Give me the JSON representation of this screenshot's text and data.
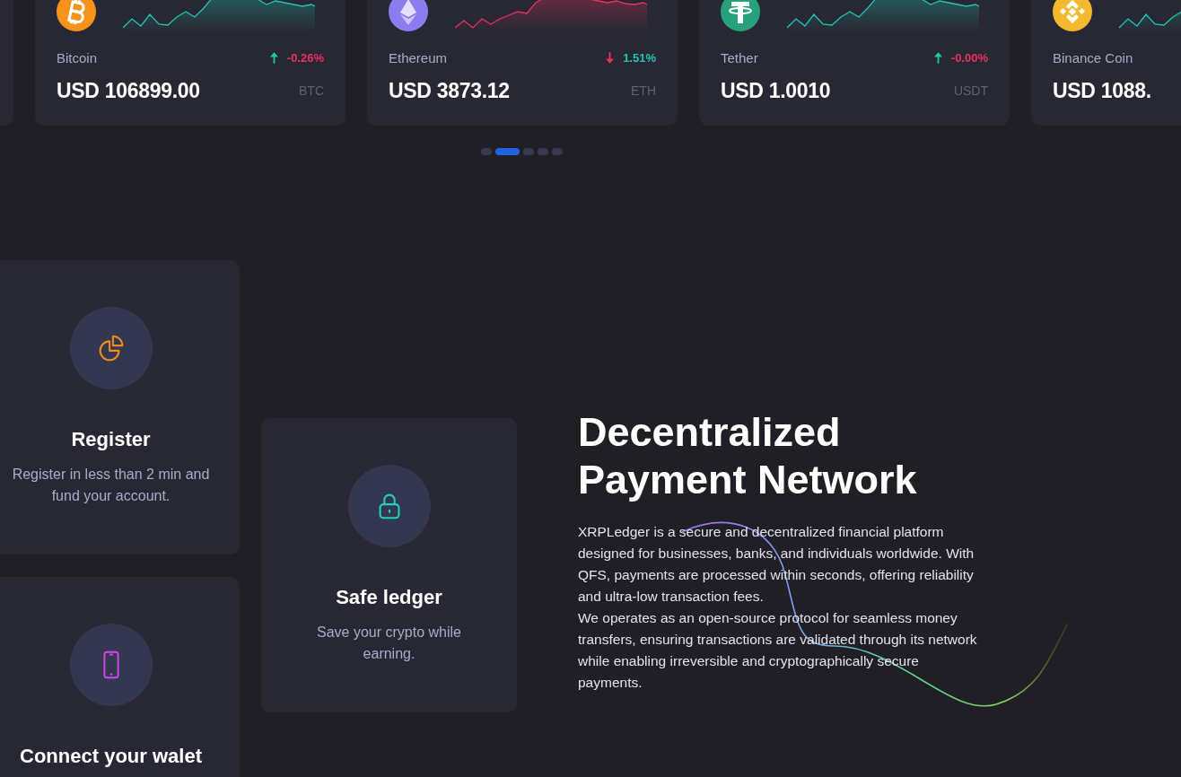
{
  "tickers": [
    {
      "kind": "bitcoin",
      "name": "Bitcoin",
      "rising": true,
      "change": "-0.26%",
      "loss": true,
      "price": "USD 106899.00",
      "symbol": "BTC",
      "chart_falling": false
    },
    {
      "kind": "ethereum",
      "name": "Ethereum",
      "rising": false,
      "change": "1.51%",
      "loss": false,
      "price": "USD 3873.12",
      "symbol": "ETH",
      "chart_falling": true
    },
    {
      "kind": "tether",
      "name": "Tether",
      "rising": true,
      "change": "-0.00%",
      "loss": true,
      "price": "USD 1.0010",
      "symbol": "USDT",
      "chart_falling": false
    },
    {
      "kind": "binance",
      "name": "Binance Coin",
      "price": "USD 1088.",
      "chart_falling": false
    }
  ],
  "pager": [
    {
      "selected": false
    },
    {
      "selected": true
    },
    {
      "selected": false
    },
    {
      "selected": false
    },
    {
      "selected": false
    }
  ],
  "features": [
    {
      "kind": "chart",
      "title": "Register",
      "text": "Register in less than 2 min and fund your account."
    },
    {
      "kind": "phone",
      "title": "Connect your walet"
    },
    {
      "kind": "lock",
      "title": "Safe ledger",
      "text": "Save your crypto while earning."
    }
  ],
  "about": {
    "heading": "Decentralized Payment Network",
    "paragraphs": [
      "XRPLedger is a secure and decentralized financial platform designed for businesses, banks, and individuals worldwide. With QFS, payments are processed within seconds, offering reliability and ultra-low transaction fees.",
      "We operates as an open-source protocol for seamless money transfers, ensuring transactions are validated through its network while enabling irreversible and cryptographically secure payments."
    ]
  }
}
